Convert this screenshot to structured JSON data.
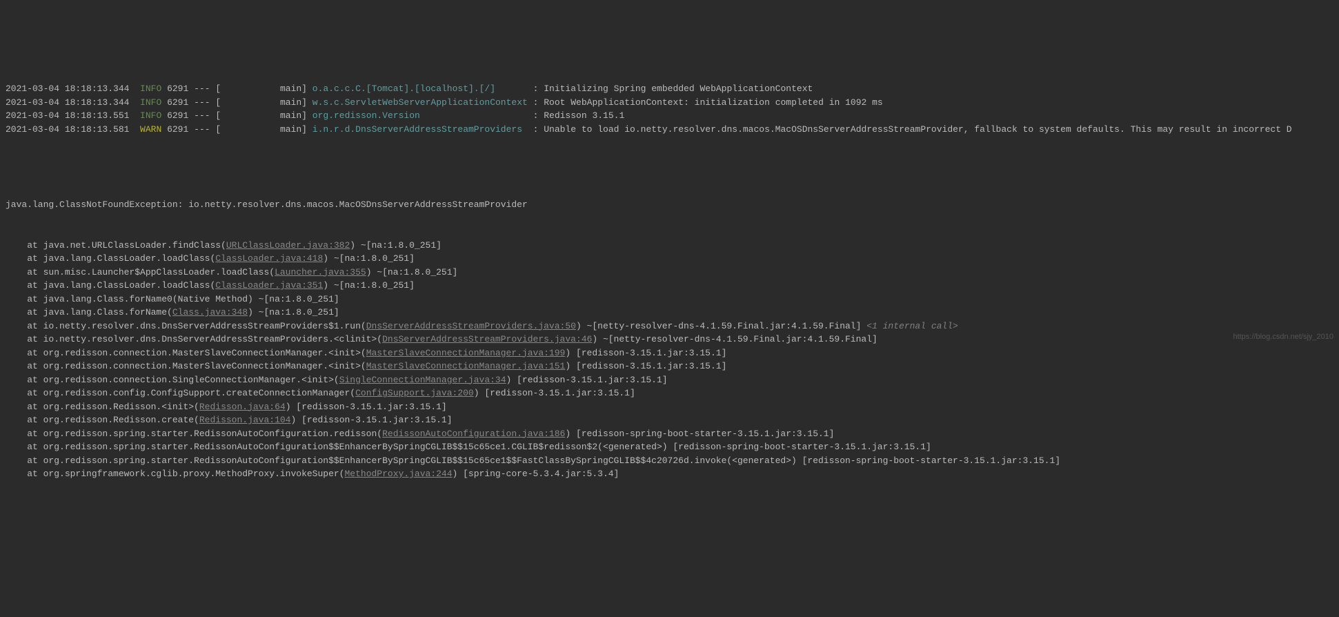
{
  "logs": [
    {
      "ts": "2021-03-04 18:18:13.344",
      "lvl": "INFO",
      "pid": "6291",
      "dash": "---",
      "thread": "[           main]",
      "logger": "o.a.c.c.C.[Tomcat].[localhost].[/]",
      "lc": "logger-cyan",
      "pad": "       ",
      "msg": ": Initializing Spring embedded WebApplicationContext"
    },
    {
      "ts": "2021-03-04 18:18:13.344",
      "lvl": "INFO",
      "pid": "6291",
      "dash": "---",
      "thread": "[           main]",
      "logger": "w.s.c.ServletWebServerApplicationContext",
      "lc": "logger-cyan",
      "pad": " ",
      "msg": ": Root WebApplicationContext: initialization completed in 1092 ms"
    },
    {
      "ts": "2021-03-04 18:18:13.551",
      "lvl": "INFO",
      "pid": "6291",
      "dash": "---",
      "thread": "[           main]",
      "logger": "org.redisson.Version",
      "lc": "logger-cyan",
      "pad": "                     ",
      "msg": ": Redisson 3.15.1"
    },
    {
      "ts": "2021-03-04 18:18:13.581",
      "lvl": "WARN",
      "pid": "6291",
      "dash": "---",
      "thread": "[           main]",
      "logger": "i.n.r.d.DnsServerAddressStreamProviders",
      "lc": "logger-cyan",
      "pad": "  ",
      "msg": ": Unable to load io.netty.resolver.dns.macos.MacOSDnsServerAddressStreamProvider, fallback to system defaults. This may result in incorrect D"
    }
  ],
  "exception_header": "java.lang.ClassNotFoundException: io.netty.resolver.dns.macos.MacOSDnsServerAddressStreamProvider",
  "stack": [
    {
      "pre": "    at java.net.URLClassLoader.findClass(",
      "link": "URLClassLoader.java:382",
      "post": ") ~[na:1.8.0_251]"
    },
    {
      "pre": "    at java.lang.ClassLoader.loadClass(",
      "link": "ClassLoader.java:418",
      "post": ") ~[na:1.8.0_251]"
    },
    {
      "pre": "    at sun.misc.Launcher$AppClassLoader.loadClass(",
      "link": "Launcher.java:355",
      "post": ") ~[na:1.8.0_251]"
    },
    {
      "pre": "    at java.lang.ClassLoader.loadClass(",
      "link": "ClassLoader.java:351",
      "post": ") ~[na:1.8.0_251]"
    },
    {
      "pre": "    at java.lang.Class.forName0(Native Method) ~[na:1.8.0_251]",
      "link": "",
      "post": ""
    },
    {
      "pre": "    at java.lang.Class.forName(",
      "link": "Class.java:348",
      "post": ") ~[na:1.8.0_251]"
    },
    {
      "pre": "    at io.netty.resolver.dns.DnsServerAddressStreamProviders$1.run(",
      "link": "DnsServerAddressStreamProviders.java:50",
      "post": ") ~[netty-resolver-dns-4.1.59.Final.jar:4.1.59.Final]",
      "tail": " <1 internal call>"
    },
    {
      "pre": "    at io.netty.resolver.dns.DnsServerAddressStreamProviders.<clinit>(",
      "link": "DnsServerAddressStreamProviders.java:46",
      "post": ") ~[netty-resolver-dns-4.1.59.Final.jar:4.1.59.Final]"
    },
    {
      "pre": "    at org.redisson.connection.MasterSlaveConnectionManager.<init>(",
      "link": "MasterSlaveConnectionManager.java:199",
      "post": ") [redisson-3.15.1.jar:3.15.1]"
    },
    {
      "pre": "    at org.redisson.connection.MasterSlaveConnectionManager.<init>(",
      "link": "MasterSlaveConnectionManager.java:151",
      "post": ") [redisson-3.15.1.jar:3.15.1]"
    },
    {
      "pre": "    at org.redisson.connection.SingleConnectionManager.<init>(",
      "link": "SingleConnectionManager.java:34",
      "post": ") [redisson-3.15.1.jar:3.15.1]"
    },
    {
      "pre": "    at org.redisson.config.ConfigSupport.createConnectionManager(",
      "link": "ConfigSupport.java:200",
      "post": ") [redisson-3.15.1.jar:3.15.1]"
    },
    {
      "pre": "    at org.redisson.Redisson.<init>(",
      "link": "Redisson.java:64",
      "post": ") [redisson-3.15.1.jar:3.15.1]"
    },
    {
      "pre": "    at org.redisson.Redisson.create(",
      "link": "Redisson.java:104",
      "post": ") [redisson-3.15.1.jar:3.15.1]"
    },
    {
      "pre": "    at org.redisson.spring.starter.RedissonAutoConfiguration.redisson(",
      "link": "RedissonAutoConfiguration.java:186",
      "post": ") [redisson-spring-boot-starter-3.15.1.jar:3.15.1]"
    },
    {
      "pre": "    at org.redisson.spring.starter.RedissonAutoConfiguration$$EnhancerBySpringCGLIB$$15c65ce1.CGLIB$redisson$2(<generated>) [redisson-spring-boot-starter-3.15.1.jar:3.15.1]",
      "link": "",
      "post": ""
    },
    {
      "pre": "    at org.redisson.spring.starter.RedissonAutoConfiguration$$EnhancerBySpringCGLIB$$15c65ce1$$FastClassBySpringCGLIB$$4c20726d.invoke(<generated>) [redisson-spring-boot-starter-3.15.1.jar:3.15.1]",
      "link": "",
      "post": ""
    },
    {
      "pre": "    at org.springframework.cglib.proxy.MethodProxy.invokeSuper(",
      "link": "MethodProxy.java:244",
      "post": ") [spring-core-5.3.4.jar:5.3.4]"
    }
  ],
  "watermark": "https://blog.csdn.net/sjy_2010"
}
